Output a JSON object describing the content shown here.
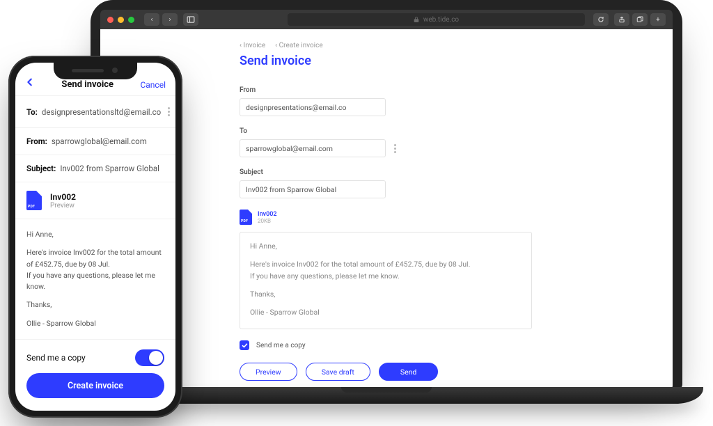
{
  "browser": {
    "url_host": "web.tide.co"
  },
  "web": {
    "breadcrumbs": [
      "Invoice",
      "Create invoice"
    ],
    "page_title": "Send invoice",
    "from_label": "From",
    "from_value": "designpresentations@email.co",
    "to_label": "To",
    "to_value": "sparrowglobal@email.com",
    "subject_label": "Subject",
    "subject_value": "Inv002 from Sparrow Global",
    "attachment": {
      "badge": "PDF",
      "name": "Inv002",
      "size": "20KB"
    },
    "message": {
      "greeting": "Hi Anne,",
      "line1": "Here's invoice Inv002 for the total amount of £452.75, due by 08 Jul.",
      "line2": "If you have any questions, please let me know.",
      "thanks": "Thanks,",
      "sign": "Ollie - Sparrow Global"
    },
    "send_copy_label": "Send me a copy",
    "send_copy_checked": true,
    "buttons": {
      "preview": "Preview",
      "save_draft": "Save draft",
      "send": "Send"
    }
  },
  "phone": {
    "header_title": "Send invoice",
    "cancel": "Cancel",
    "to_label": "To:",
    "to_value": "designpresentationsltd@email.co",
    "from_label": "From:",
    "from_value": "sparrowglobal@email.com",
    "subject_label": "Subject:",
    "subject_value": "Inv002 from Sparrow Global",
    "attachment": {
      "badge": "PDF",
      "name": "Inv002",
      "preview": "Preview"
    },
    "message": {
      "greeting": "Hi Anne,",
      "line1": "Here's invoice Inv002 for the total amount of £452.75, due by 08 Jul.",
      "line2": "If you have any questions, please let me know.",
      "thanks": "Thanks,",
      "sign": "Ollie - Sparrow Global"
    },
    "send_copy_label": "Send me a copy",
    "send_copy_on": true,
    "cta": "Create invoice"
  }
}
